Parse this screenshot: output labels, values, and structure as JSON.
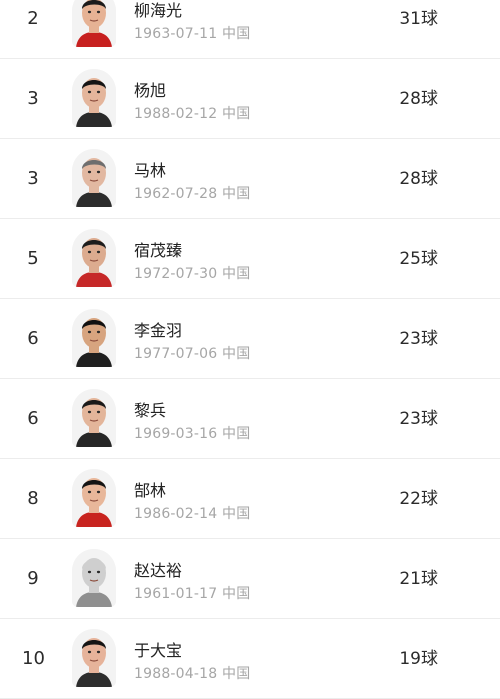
{
  "colors": {
    "text": "#2b2b2b",
    "meta": "#a6a6a6",
    "divider": "#ececec"
  },
  "players": [
    {
      "rank": "2",
      "name": "柳海光",
      "birth": "1963-07-11",
      "country": "中国",
      "goals": "31球",
      "avatar": "player-photo",
      "skin": "#e6b294",
      "hair": "#1b1b1b",
      "shirt": "#c7201f"
    },
    {
      "rank": "3",
      "name": "杨旭",
      "birth": "1988-02-12",
      "country": "中国",
      "goals": "28球",
      "avatar": "player-photo",
      "skin": "#e4b59b",
      "hair": "#151515",
      "shirt": "#2a2a2a"
    },
    {
      "rank": "3",
      "name": "马林",
      "birth": "1962-07-28",
      "country": "中国",
      "goals": "28球",
      "avatar": "player-photo",
      "skin": "#e2b8a1",
      "hair": "#6e6e6e",
      "shirt": "#2c2c2c"
    },
    {
      "rank": "5",
      "name": "宿茂臻",
      "birth": "1972-07-30",
      "country": "中国",
      "goals": "25球",
      "avatar": "player-photo",
      "skin": "#dcab8f",
      "hair": "#1d1d1d",
      "shirt": "#c62828"
    },
    {
      "rank": "6",
      "name": "李金羽",
      "birth": "1977-07-06",
      "country": "中国",
      "goals": "23球",
      "avatar": "player-photo",
      "skin": "#d7a47f",
      "hair": "#111111",
      "shirt": "#1f1f1f"
    },
    {
      "rank": "6",
      "name": "黎兵",
      "birth": "1969-03-16",
      "country": "中国",
      "goals": "23球",
      "avatar": "player-photo",
      "skin": "#e3b59a",
      "hair": "#1a1a1a",
      "shirt": "#262626"
    },
    {
      "rank": "8",
      "name": "郜林",
      "birth": "1986-02-14",
      "country": "中国",
      "goals": "22球",
      "avatar": "player-photo",
      "skin": "#e8b79a",
      "hair": "#141414",
      "shirt": "#c8241f"
    },
    {
      "rank": "9",
      "name": "赵达裕",
      "birth": "1961-01-17",
      "country": "中国",
      "goals": "21球",
      "avatar": "player-photo",
      "skin": "#cfcfcf",
      "hair": "#cfcfcf",
      "shirt": "#8f8f8f"
    },
    {
      "rank": "10",
      "name": "于大宝",
      "birth": "1988-04-18",
      "country": "中国",
      "goals": "19球",
      "avatar": "player-photo",
      "skin": "#e6b39a",
      "hair": "#151515",
      "shirt": "#2d2d2d"
    }
  ]
}
